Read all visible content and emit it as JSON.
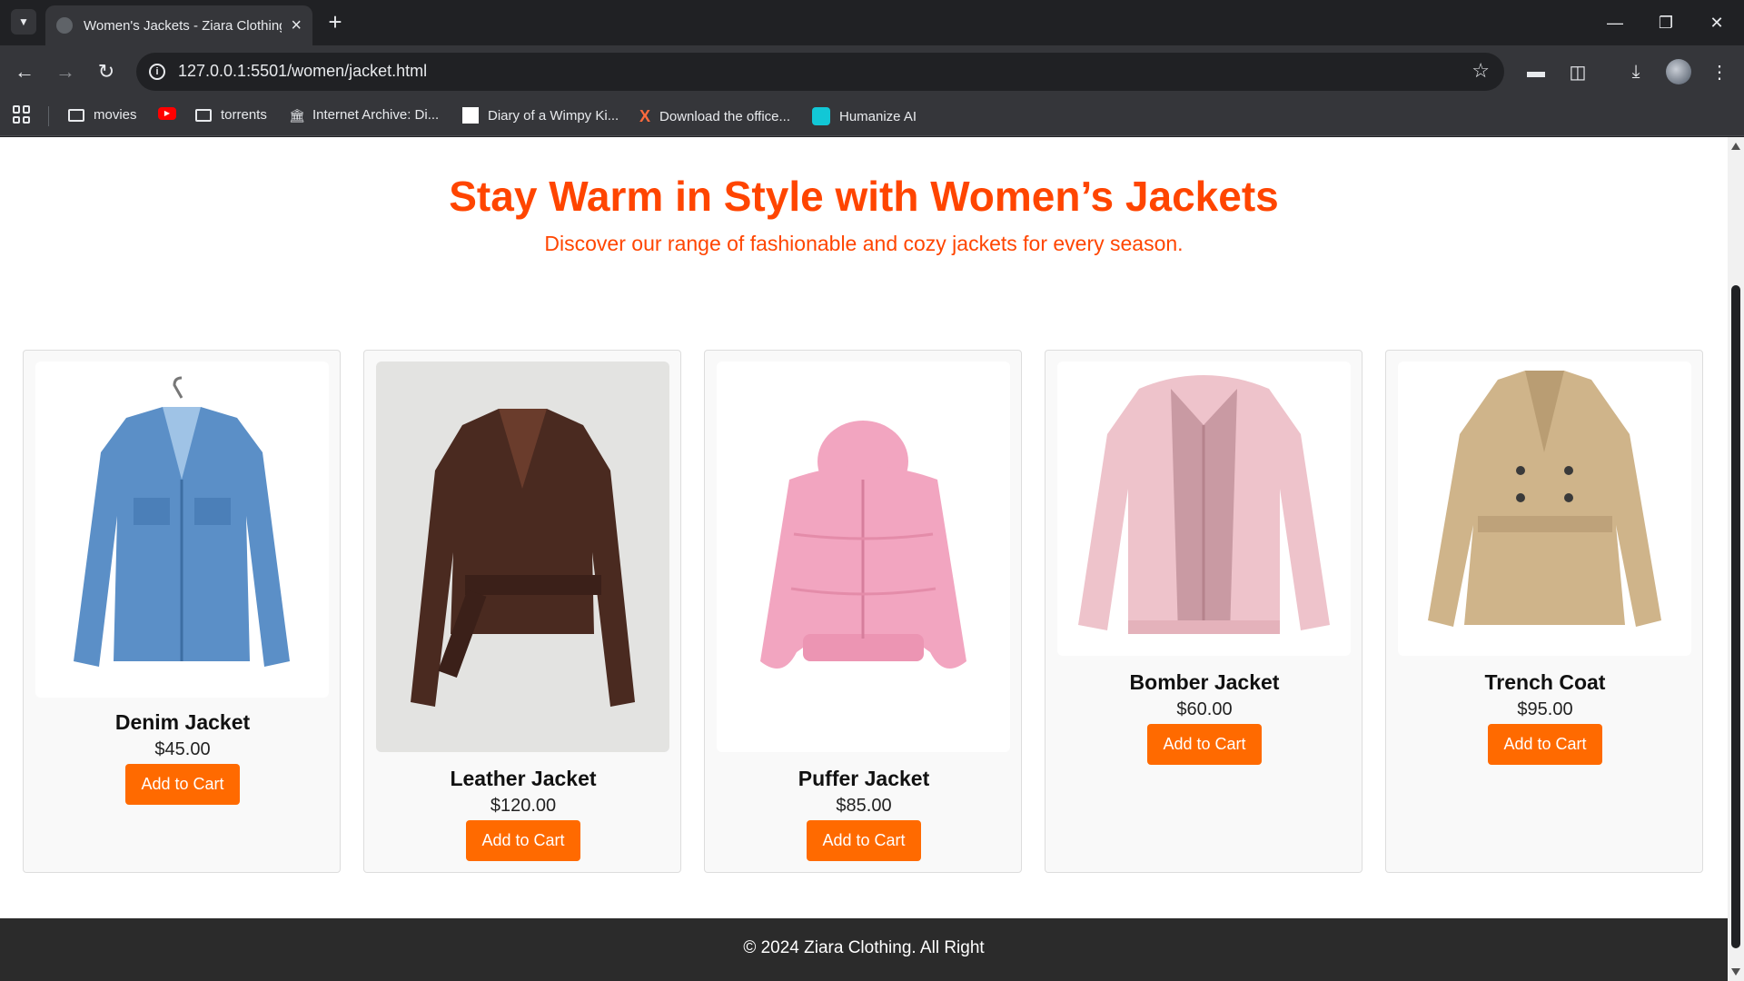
{
  "browser": {
    "tab_title": "Women's Jackets - Ziara Clothing",
    "url": "127.0.0.1:5501/women/jacket.html",
    "bookmarks": [
      {
        "label": "movies",
        "icon": "folder-icon"
      },
      {
        "label": "",
        "icon": "youtube-icon"
      },
      {
        "label": "torrents",
        "icon": "folder-icon"
      },
      {
        "label": "Internet Archive: Di...",
        "icon": "archive-icon"
      },
      {
        "label": "Diary of a Wimpy Ki...",
        "icon": "blank-page-icon"
      },
      {
        "label": "Download the office...",
        "icon": "x-logo-icon"
      },
      {
        "label": "Humanize AI",
        "icon": "humanize-icon"
      }
    ]
  },
  "hero": {
    "title": "Stay Warm in Style with Women’s Jackets",
    "subtitle": "Discover our range of fashionable and cozy jackets for every season."
  },
  "products": [
    {
      "name": "Denim Jacket",
      "price": "$45.00",
      "button": "Add to Cart",
      "color": "#5b8fc7"
    },
    {
      "name": "Leather Jacket",
      "price": "$120.00",
      "button": "Add to Cart",
      "color": "#4a2a20"
    },
    {
      "name": "Puffer Jacket",
      "price": "$85.00",
      "button": "Add to Cart",
      "color": "#f2a5c0"
    },
    {
      "name": "Bomber Jacket",
      "price": "$60.00",
      "button": "Add to Cart",
      "color": "#eec3cb"
    },
    {
      "name": "Trench Coat",
      "price": "$95.00",
      "button": "Add to Cart",
      "color": "#cfb48a"
    }
  ],
  "footer": {
    "text": "© 2024 Ziara Clothing. All Right"
  },
  "colors": {
    "accent": "#ff4500",
    "button": "#ff6a00",
    "footer_bg": "#2b2b2b"
  }
}
